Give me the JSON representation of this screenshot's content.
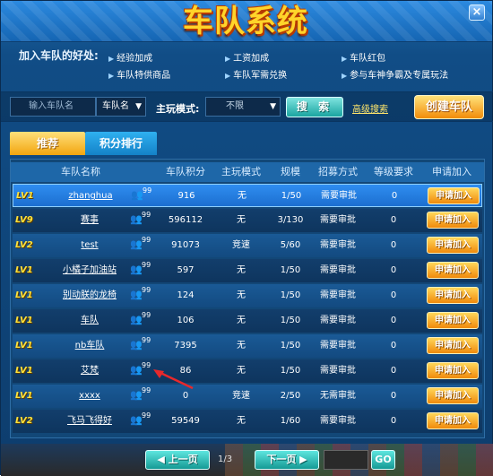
{
  "header": {
    "title": "车队系统",
    "close_label": "×"
  },
  "benefits": {
    "label": "加入车队的好处:",
    "items": [
      "经验加成",
      "工资加成",
      "车队红包",
      "车队特供商品",
      "车队军需兑换",
      "参与车神争霸及专属玩法"
    ]
  },
  "search": {
    "name_placeholder": "输入车队名",
    "name_select": "车队名",
    "mode_label": "主玩模式:",
    "mode_select": "不限",
    "search_label": "搜 索",
    "advanced_label": "高级搜索",
    "create_label": "创建车队"
  },
  "tabs": {
    "recommend": "推荐",
    "rank": "积分排行"
  },
  "table": {
    "headers": [
      "车队名称",
      "车队积分",
      "主玩模式",
      "规模",
      "招募方式",
      "等级要求",
      "申请加入"
    ],
    "member_badge": "99",
    "apply_label": "申请加入",
    "rows": [
      {
        "level": "LV1",
        "name": "zhanghua",
        "score": "916",
        "mode": "无",
        "scale": "1/50",
        "recruit": "需要审批",
        "req": "0"
      },
      {
        "level": "LV9",
        "name": "赛事",
        "score": "596112",
        "mode": "无",
        "scale": "3/130",
        "recruit": "需要审批",
        "req": "0"
      },
      {
        "level": "LV2",
        "name": "test",
        "score": "91073",
        "mode": "竞速",
        "scale": "5/60",
        "recruit": "需要审批",
        "req": "0"
      },
      {
        "level": "LV1",
        "name": "小橘子加油站",
        "score": "597",
        "mode": "无",
        "scale": "1/50",
        "recruit": "需要审批",
        "req": "0"
      },
      {
        "level": "LV1",
        "name": "别动朕的龙椅",
        "score": "124",
        "mode": "无",
        "scale": "1/50",
        "recruit": "需要审批",
        "req": "0"
      },
      {
        "level": "LV1",
        "name": "车队",
        "score": "106",
        "mode": "无",
        "scale": "1/50",
        "recruit": "需要审批",
        "req": "0"
      },
      {
        "level": "LV1",
        "name": "nb车队",
        "score": "7395",
        "mode": "无",
        "scale": "1/50",
        "recruit": "需要审批",
        "req": "0"
      },
      {
        "level": "LV1",
        "name": "艾梵",
        "score": "86",
        "mode": "无",
        "scale": "1/50",
        "recruit": "需要审批",
        "req": "0"
      },
      {
        "level": "LV1",
        "name": "xxxx",
        "score": "0",
        "mode": "竞速",
        "scale": "2/50",
        "recruit": "无需审批",
        "req": "0"
      },
      {
        "level": "LV2",
        "name": "飞马飞得好",
        "score": "59549",
        "mode": "无",
        "scale": "1/60",
        "recruit": "需要审批",
        "req": "0"
      }
    ]
  },
  "pagination": {
    "prev_label": "上一页",
    "page_info": "1/3",
    "next_label": "下一页",
    "go_label": "GO"
  }
}
